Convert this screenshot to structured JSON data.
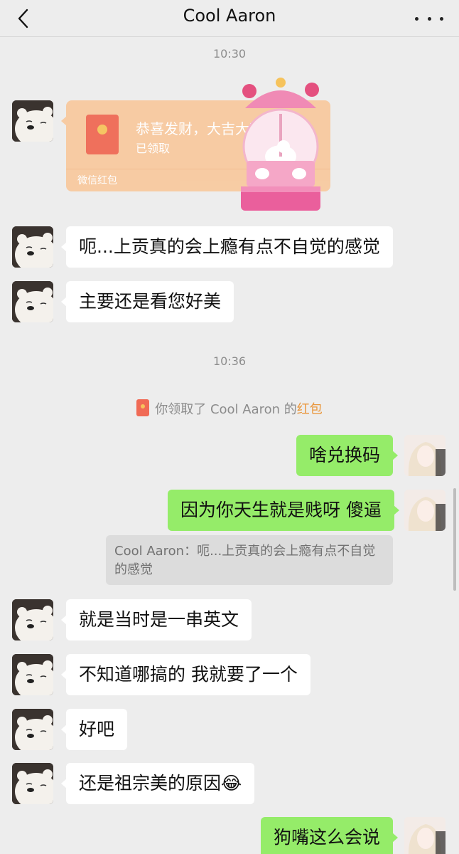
{
  "header": {
    "title": "Cool Aaron",
    "back_icon": "chevron-left-icon",
    "more_icon": "more-dots-icon"
  },
  "timestamps": [
    "10:30",
    "10:36"
  ],
  "red_packet": {
    "title": "恭喜发财，大吉大利",
    "status": "已领取",
    "source": "微信红包"
  },
  "messages": [
    {
      "side": "left",
      "text": "呃...上贡真的会上瘾有点不自觉的感觉"
    },
    {
      "side": "left",
      "text": "主要还是看您好美"
    },
    {
      "side": "right",
      "text": "啥兑换码"
    },
    {
      "side": "right",
      "text": "因为你天生就是贱呀 傻逼"
    },
    {
      "side": "left",
      "text": "就是当时是一串英文"
    },
    {
      "side": "left",
      "text": "不知道哪搞的 我就要了一个"
    },
    {
      "side": "left",
      "text": "好吧"
    },
    {
      "side": "left",
      "text": "还是祖宗美的原因😂"
    },
    {
      "side": "right",
      "text": "狗嘴这么会说"
    }
  ],
  "system_notice": {
    "prefix": "你领取了 Cool Aaron 的",
    "highlight": "红包"
  },
  "quote": {
    "text": "Cool Aaron：呃...上贡真的会上瘾有点不自觉的感觉"
  },
  "colors": {
    "background": "#ededed",
    "bubble_self": "#95ec69",
    "bubble_other": "#ffffff",
    "red_packet": "#f8caa0",
    "highlight": "#e9963b"
  }
}
